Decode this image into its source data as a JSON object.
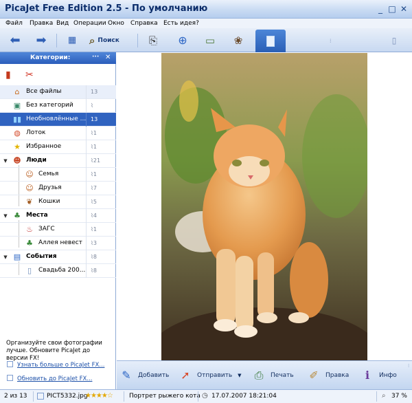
{
  "window": {
    "title": "PicaJet Free Edition 2.5  - По умолчанию"
  },
  "menu": [
    "Файл",
    "Правка",
    "Вид",
    "Операции",
    "Окно",
    "Справка",
    "Есть идея?"
  ],
  "toolbar": {
    "search_label": "Поиск"
  },
  "sidebar": {
    "header": "Категории:",
    "header_dots": "···",
    "items": [
      {
        "label": "Все файлы",
        "count": "13"
      },
      {
        "label": "Без категорий",
        "count": ""
      },
      {
        "label": "Необновлённые ...",
        "count": "13"
      },
      {
        "label": "Лоток",
        "count": "1"
      },
      {
        "label": "Избранное",
        "count": "1"
      },
      {
        "label": "Люди",
        "count": "21"
      },
      {
        "label": "Семья",
        "count": "1"
      },
      {
        "label": "Друзья",
        "count": "7"
      },
      {
        "label": "Кошки",
        "count": "5"
      },
      {
        "label": "Места",
        "count": "4"
      },
      {
        "label": "ЗАГС",
        "count": "1"
      },
      {
        "label": "Аллея невест",
        "count": "3"
      },
      {
        "label": "События",
        "count": "8"
      },
      {
        "label": "Свадьба 200...",
        "count": "8"
      }
    ],
    "promo_text": "Организуйте свои фотографии лучше. Обновите PicaJet до версии FX!",
    "link1": "Узнать больше о PicaJet FX...",
    "link2": "Обновить до PicaJet FX..."
  },
  "actions": [
    "Добавить",
    "Отправить",
    "Печать",
    "Правка",
    "Инфо"
  ],
  "status": {
    "position": "2 из 13",
    "filename": "PICT5332.jpg",
    "rating": "★★★★☆",
    "caption": "Портрет рыжего кота",
    "datetime": "17.07.2007 18:21:04",
    "zoom": "37 %"
  }
}
